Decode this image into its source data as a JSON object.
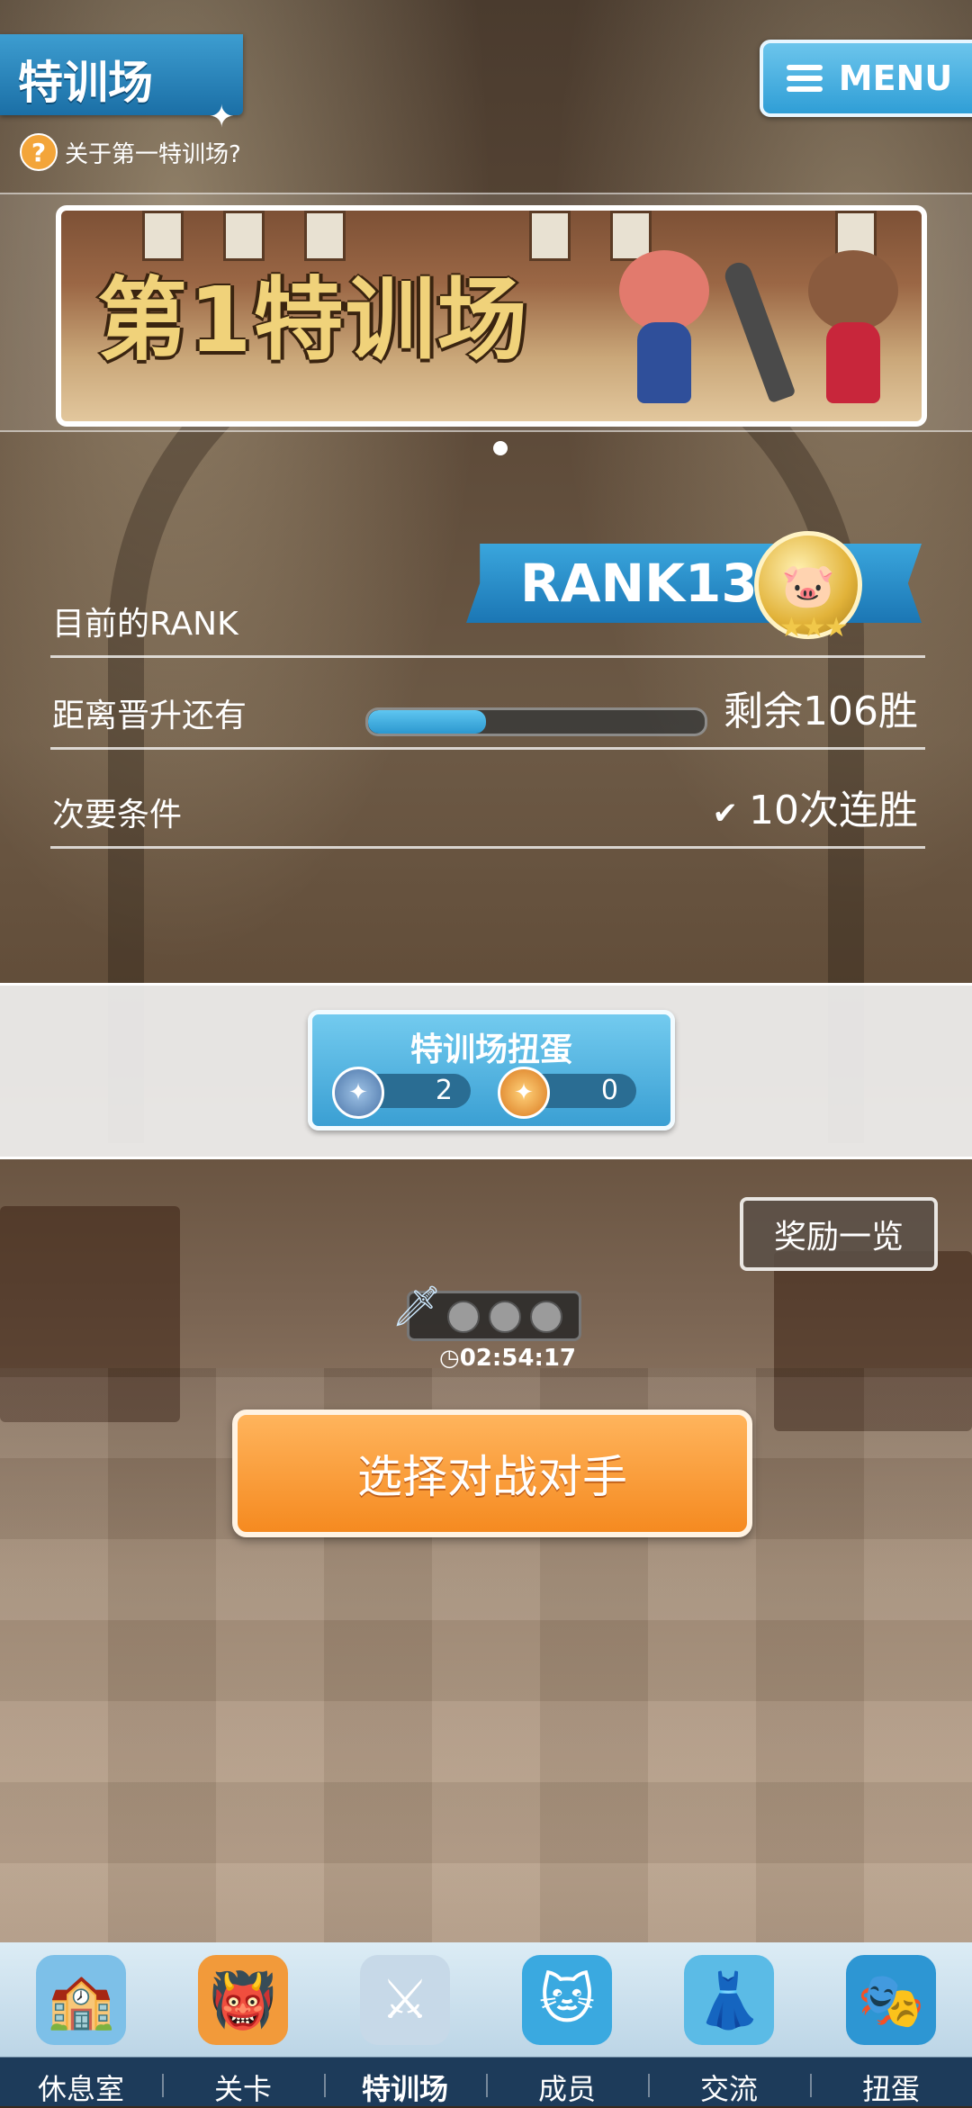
{
  "header": {
    "title": "特训场",
    "help_link": "关于第一特训场?",
    "menu_label": "MENU"
  },
  "banner": {
    "title": "第1特训场"
  },
  "rank": {
    "label": "目前的RANK",
    "value": "RANK13"
  },
  "promotion": {
    "label": "距离晋升还有",
    "remaining": "剩余106胜",
    "progress": 0.35
  },
  "secondary": {
    "label": "次要条件",
    "value": "10次连胜"
  },
  "gacha": {
    "title": "特训场扭蛋",
    "silver_count": "2",
    "gold_count": "0"
  },
  "rewards_label": "奖励一览",
  "timer": "02:54:17",
  "battle_button": "选择对战对手",
  "nav": {
    "items": [
      {
        "label": "休息室",
        "icon": "school-building-icon"
      },
      {
        "label": "关卡",
        "icon": "monster-icon"
      },
      {
        "label": "特训场",
        "icon": "crossed-swords-icon"
      },
      {
        "label": "成员",
        "icon": "cat-member-icon"
      },
      {
        "label": "交流",
        "icon": "dress-icon"
      },
      {
        "label": "扭蛋",
        "icon": "curtain-icon"
      }
    ]
  }
}
